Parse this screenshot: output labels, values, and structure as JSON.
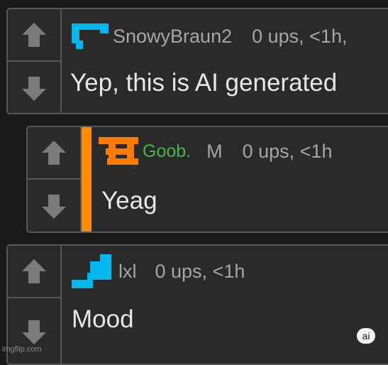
{
  "colors": {
    "background": "#1a1a1b",
    "card": "#2a2a2b",
    "border": "#555657",
    "arrow": "#7b7b7b",
    "nested_bar": "#ff8c00",
    "username_highlight": "#4caf50",
    "avatar_blue": "#00b7f0",
    "avatar_orange": "#ff7a00"
  },
  "comments": [
    {
      "username": "SnowyBraun2",
      "meta": "0 ups, <1h,",
      "body": "Yep, this is AI generated",
      "avatar_icon": "blue-pixel-bracket-icon"
    },
    {
      "username": "Goob.",
      "badge": "M",
      "meta": "0 ups, <1h",
      "body": "Yeag",
      "avatar_icon": "orange-pixel-avatar-icon"
    },
    {
      "username": "lxl",
      "meta": "0 ups, <1h",
      "body": "Mood",
      "avatar_icon": "blue-pixel-step-icon"
    }
  ],
  "vote_icons": {
    "up": "up-arrow-icon",
    "down": "down-arrow-icon"
  },
  "ai_badge": "ai",
  "watermark": "imgflip.com"
}
